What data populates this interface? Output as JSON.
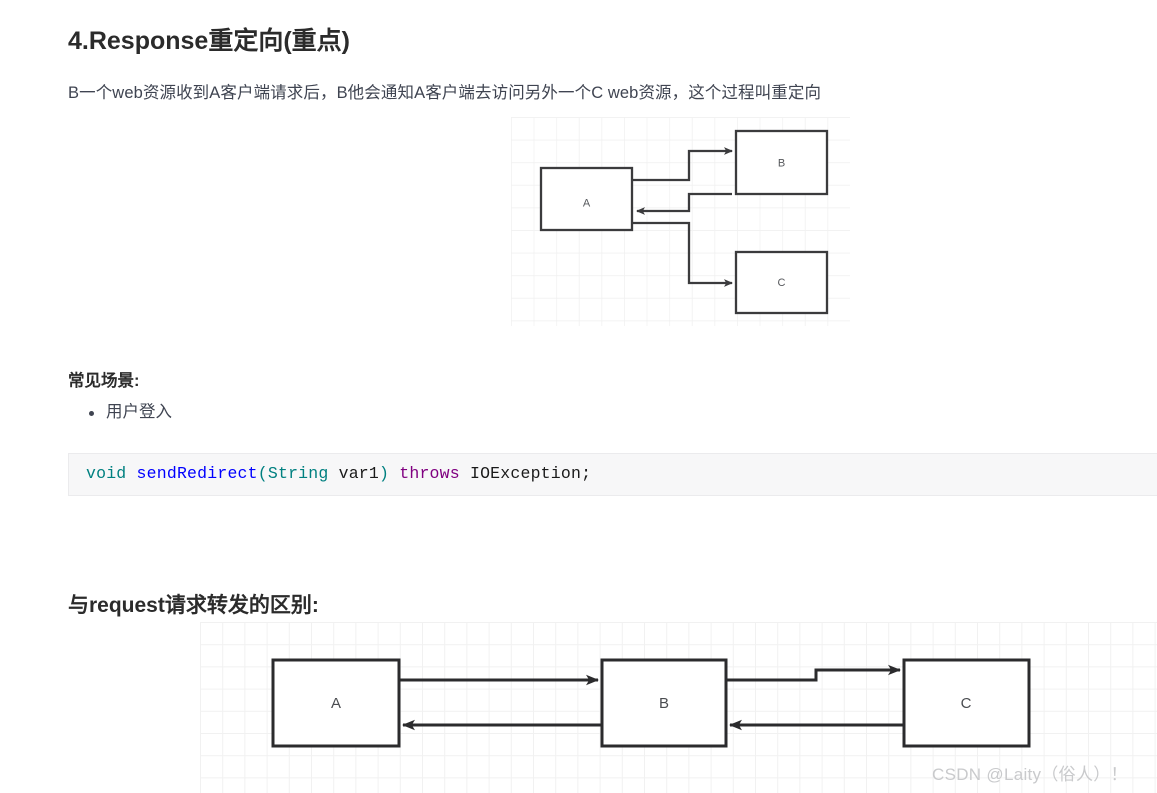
{
  "article": {
    "heading": "4.Response重定向(重点)",
    "intro": "B一个web资源收到A客户端请求后，B他会通知A客户端去访问另外一个C web资源，这个过程叫重定向",
    "scenarios_heading": "常见场景:",
    "scenarios": [
      "用户登入"
    ],
    "comparison_heading": "与request请求转发的区别:"
  },
  "code_block": {
    "language": "java",
    "full_text": "void sendRedirect(String var1) throws IOException;",
    "tokens": [
      {
        "text": "void",
        "kind": "type"
      },
      {
        "text": " ",
        "kind": "plain"
      },
      {
        "text": "sendRedirect",
        "kind": "fn"
      },
      {
        "text": "(",
        "kind": "type"
      },
      {
        "text": "String",
        "kind": "type"
      },
      {
        "text": " var1",
        "kind": "plain"
      },
      {
        "text": ")",
        "kind": "type"
      },
      {
        "text": " ",
        "kind": "plain"
      },
      {
        "text": "throws",
        "kind": "kw"
      },
      {
        "text": " IOException;",
        "kind": "plain"
      }
    ],
    "colors": {
      "type": "#008080",
      "fn": "#0000ff",
      "kw": "#800080",
      "plain": "#1a1a1a",
      "background": "#f7f7f8"
    }
  },
  "diagram_redirect": {
    "title": "redirect-flow",
    "nodes": [
      {
        "id": "A",
        "label": "A"
      },
      {
        "id": "B",
        "label": "B"
      },
      {
        "id": "C",
        "label": "C"
      }
    ],
    "edges": [
      {
        "from": "A",
        "to": "B"
      },
      {
        "from": "B",
        "to": "A"
      },
      {
        "from": "A",
        "to": "C"
      }
    ],
    "stroke": "#3b3b3d",
    "grid_color": "#f0f0f0"
  },
  "diagram_forward": {
    "title": "forward-comparison-flow",
    "nodes": [
      {
        "id": "A",
        "label": "A"
      },
      {
        "id": "B",
        "label": "B"
      },
      {
        "id": "C",
        "label": "C"
      }
    ],
    "edges": [
      {
        "from": "A",
        "to": "B"
      },
      {
        "from": "B",
        "to": "A"
      },
      {
        "from": "B",
        "to": "C"
      },
      {
        "from": "C",
        "to": "B"
      }
    ],
    "stroke": "#2b2b2d",
    "grid_color": "#f0f0f0"
  },
  "watermark": {
    "text": "CSDN @Laity（俗人）！",
    "color": "#c9cacc"
  }
}
